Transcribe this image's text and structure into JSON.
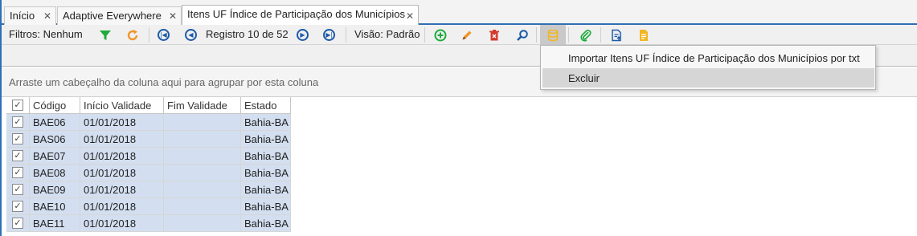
{
  "tabs": [
    {
      "label": "Início",
      "close": "✕"
    },
    {
      "label": "Adaptive Everywhere",
      "close": "✕"
    },
    {
      "label": "Itens UF Índice de Participação dos Municípios",
      "close": "✕"
    }
  ],
  "toolbar": {
    "filters_label": "Filtros: Nenhum",
    "record_label": "Registro 10 de 52",
    "view_label": "Visão: Padrão",
    "icons": [
      "funnel-icon",
      "refresh-icon",
      "first-record-icon",
      "previous-record-icon",
      "next-record-icon",
      "last-record-icon",
      "add-icon",
      "edit-pencil-icon",
      "delete-trash-icon",
      "search-magnifier-icon",
      "database-icon",
      "attachment-clip-icon",
      "export-document-icon",
      "report-document-icon"
    ],
    "colors": {
      "green": "#1faa3c",
      "orange": "#f0962b",
      "red": "#d23b2f",
      "blue": "#1d5aa8",
      "yellow": "#f3b623"
    }
  },
  "group_panel": {
    "text": "Arraste um cabeçalho da coluna aqui para agrupar por esta coluna"
  },
  "grid": {
    "check_glyph": "✓",
    "columns": [
      "Código",
      "Início Validade",
      "Fim Validade",
      "Estado"
    ],
    "rows": [
      {
        "codigo": "BAE06",
        "inicio": "01/01/2018",
        "fim": "",
        "estado": "Bahia-BA"
      },
      {
        "codigo": "BAS06",
        "inicio": "01/01/2018",
        "fim": "",
        "estado": "Bahia-BA"
      },
      {
        "codigo": "BAE07",
        "inicio": "01/01/2018",
        "fim": "",
        "estado": "Bahia-BA"
      },
      {
        "codigo": "BAE08",
        "inicio": "01/01/2018",
        "fim": "",
        "estado": "Bahia-BA"
      },
      {
        "codigo": "BAE09",
        "inicio": "01/01/2018",
        "fim": "",
        "estado": "Bahia-BA"
      },
      {
        "codigo": "BAE10",
        "inicio": "01/01/2018",
        "fim": "",
        "estado": "Bahia-BA"
      },
      {
        "codigo": "BAE11",
        "inicio": "01/01/2018",
        "fim": "",
        "estado": "Bahia-BA"
      }
    ]
  },
  "dropdown": {
    "items": [
      "Importar Itens UF Índice de Participação dos Municípios por txt",
      "Excluir"
    ]
  }
}
